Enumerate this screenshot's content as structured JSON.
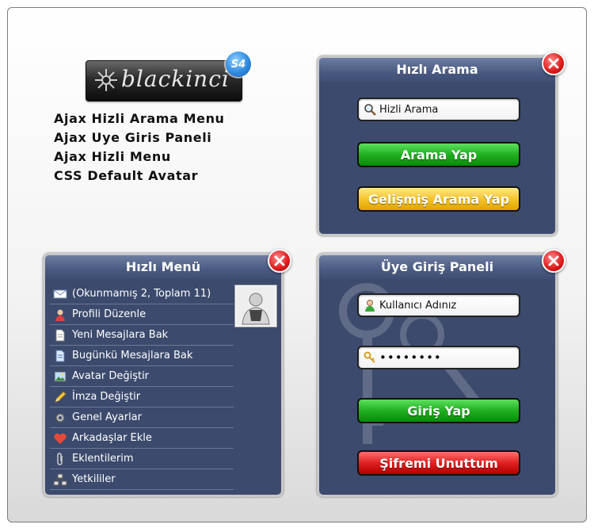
{
  "logo": {
    "text": "blackinci",
    "badge": "S4"
  },
  "features": [
    "Ajax Hizli Arama Menu",
    "Ajax Uye Giris Paneli",
    "Ajax Hizli Menu",
    "CSS Default Avatar"
  ],
  "search_panel": {
    "title": "Hızlı Arama",
    "input_value": "Hizli Arama",
    "search_button": "Arama Yap",
    "advanced_button": "Gelişmiş Arama Yap"
  },
  "menu_panel": {
    "title": "Hızlı Menü",
    "items": [
      {
        "label": "(Okunmamış 2, Toplam 11)",
        "icon": "envelope-icon"
      },
      {
        "label": "Profili Düzenle",
        "icon": "user-icon"
      },
      {
        "label": "Yeni Mesajlara Bak",
        "icon": "document-icon"
      },
      {
        "label": "Bugünkü Mesajlara Bak",
        "icon": "document-blue-icon"
      },
      {
        "label": "Avatar Değiştir",
        "icon": "picture-icon"
      },
      {
        "label": "İmza Değiştir",
        "icon": "pencil-icon"
      },
      {
        "label": "Genel Ayarlar",
        "icon": "gear-icon"
      },
      {
        "label": "Arkadaşlar Ekle",
        "icon": "heart-icon"
      },
      {
        "label": "Eklentilerim",
        "icon": "paperclip-icon"
      },
      {
        "label": "Yetkililer",
        "icon": "network-icon"
      }
    ]
  },
  "login_panel": {
    "title": "Üye Giriş Paneli",
    "username_value": "Kullanıcı Adınız",
    "password_value": "••••••••",
    "login_button": "Giriş Yap",
    "forgot_button": "Şifremi Unuttum"
  },
  "colors": {
    "panel_bg": "#3c4a6d",
    "green": "#20b020",
    "yellow": "#f5c42a",
    "red": "#e02020"
  }
}
